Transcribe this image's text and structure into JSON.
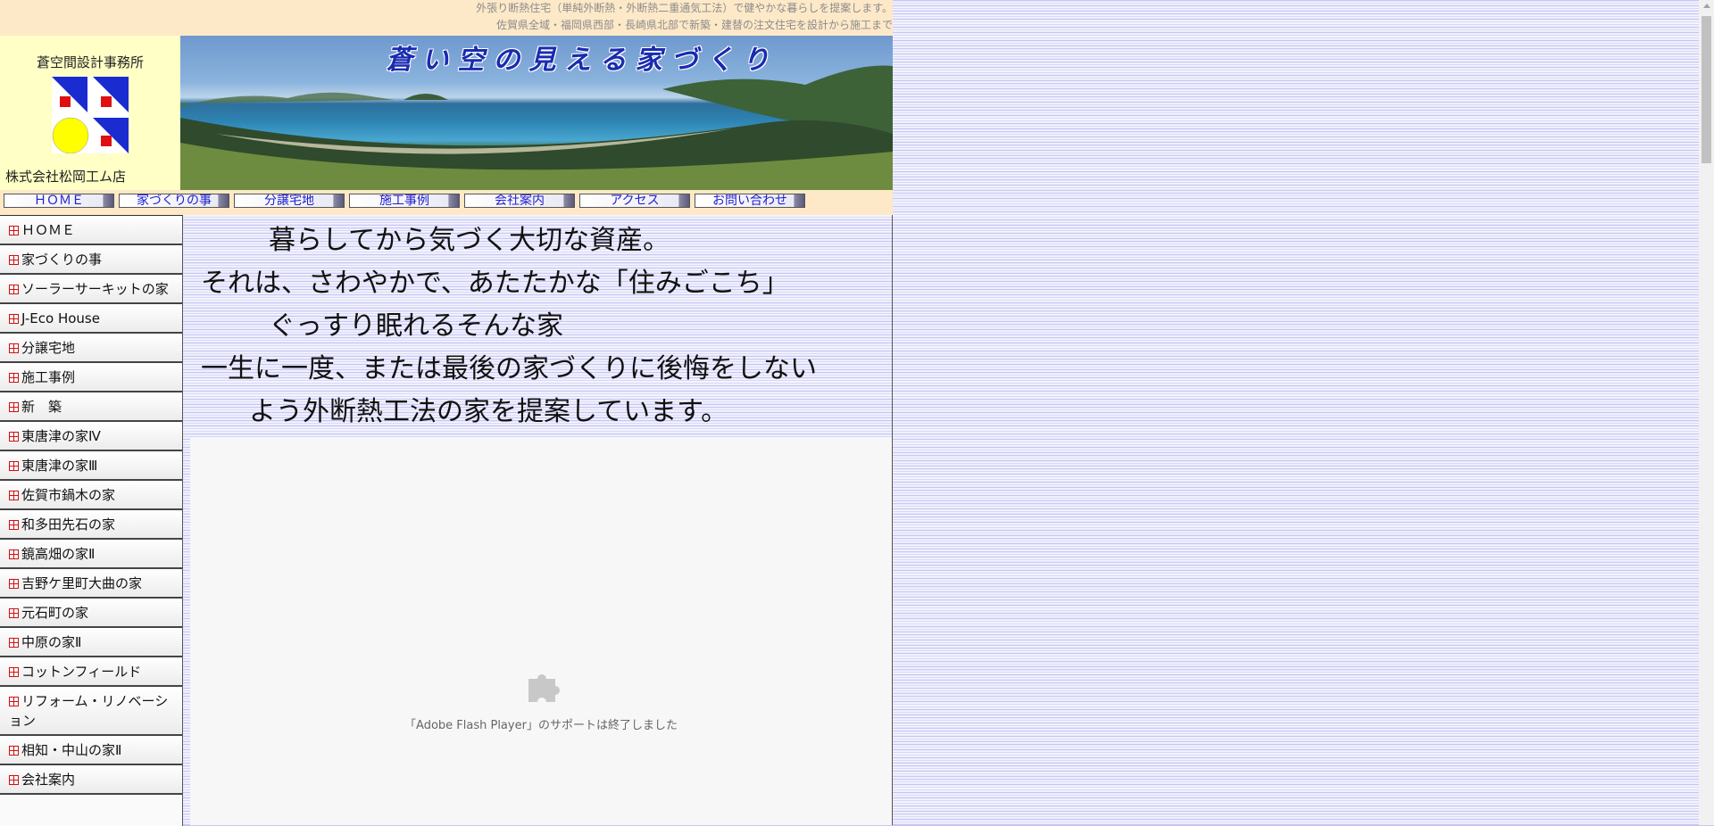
{
  "header": {
    "tagline_1": "外張り断熱住宅（単純外断熱・外断熱二重通気工法）で健やかな暮らしを提案します。",
    "tagline_2": "佐賀県全域・福岡県西部・長崎県北部で新築・建替の注文住宅を設計から施工まで",
    "office_name": "蒼空間設計事務所",
    "company_name": "株式会社松岡工ム店",
    "banner_title": "蒼い空の見える家づくり"
  },
  "nav": {
    "items": [
      {
        "label": "ＨＯＭＥ"
      },
      {
        "label": "家づくりの事"
      },
      {
        "label": "分譲宅地"
      },
      {
        "label": "施工事例"
      },
      {
        "label": "会社案内"
      },
      {
        "label": "アクセス"
      },
      {
        "label": "お問い合わせ"
      }
    ]
  },
  "sidebar": {
    "items": [
      {
        "label": "ＨＯＭＥ"
      },
      {
        "label": "家づくりの事"
      },
      {
        "label": "ソーラーサーキットの家"
      },
      {
        "label": "J-Eco House"
      },
      {
        "label": "分譲宅地"
      },
      {
        "label": "施工事例"
      },
      {
        "label": "新　築"
      },
      {
        "label": "東唐津の家Ⅳ"
      },
      {
        "label": "東唐津の家Ⅲ"
      },
      {
        "label": "佐賀市鍋木の家"
      },
      {
        "label": "和多田先石の家"
      },
      {
        "label": "鏡高畑の家Ⅱ"
      },
      {
        "label": "吉野ケ里町大曲の家"
      },
      {
        "label": "元石町の家"
      },
      {
        "label": "中原の家Ⅱ"
      },
      {
        "label": "コットンフィールド"
      },
      {
        "label": "リフォーム・リノベーション"
      },
      {
        "label": "相知・中山の家Ⅱ"
      },
      {
        "label": "会社案内"
      }
    ]
  },
  "main": {
    "hero_lines": [
      "暮らしてから気づく大切な資産。",
      "それは、さわやかで、あたたかな「住みごこち」",
      "ぐっすり眠れるそんな家",
      "一生に一度、または最後の家づくりに後悔をしない",
      "よう外断熱工法の家を提案しています。"
    ],
    "flash_message": "「Adobe Flash Player」のサポートは終了しました"
  },
  "icons": {
    "menu_bullet": "menu-bullet-icon",
    "plugin": "puzzle-piece-icon"
  },
  "colors": {
    "header_bg": "#fde9c8",
    "brand_bg": "#ffffc6",
    "nav_text": "#2020d0",
    "logo_blue": "#1a2bd0",
    "logo_red": "#e01010",
    "logo_yellow": "#ffff00"
  }
}
